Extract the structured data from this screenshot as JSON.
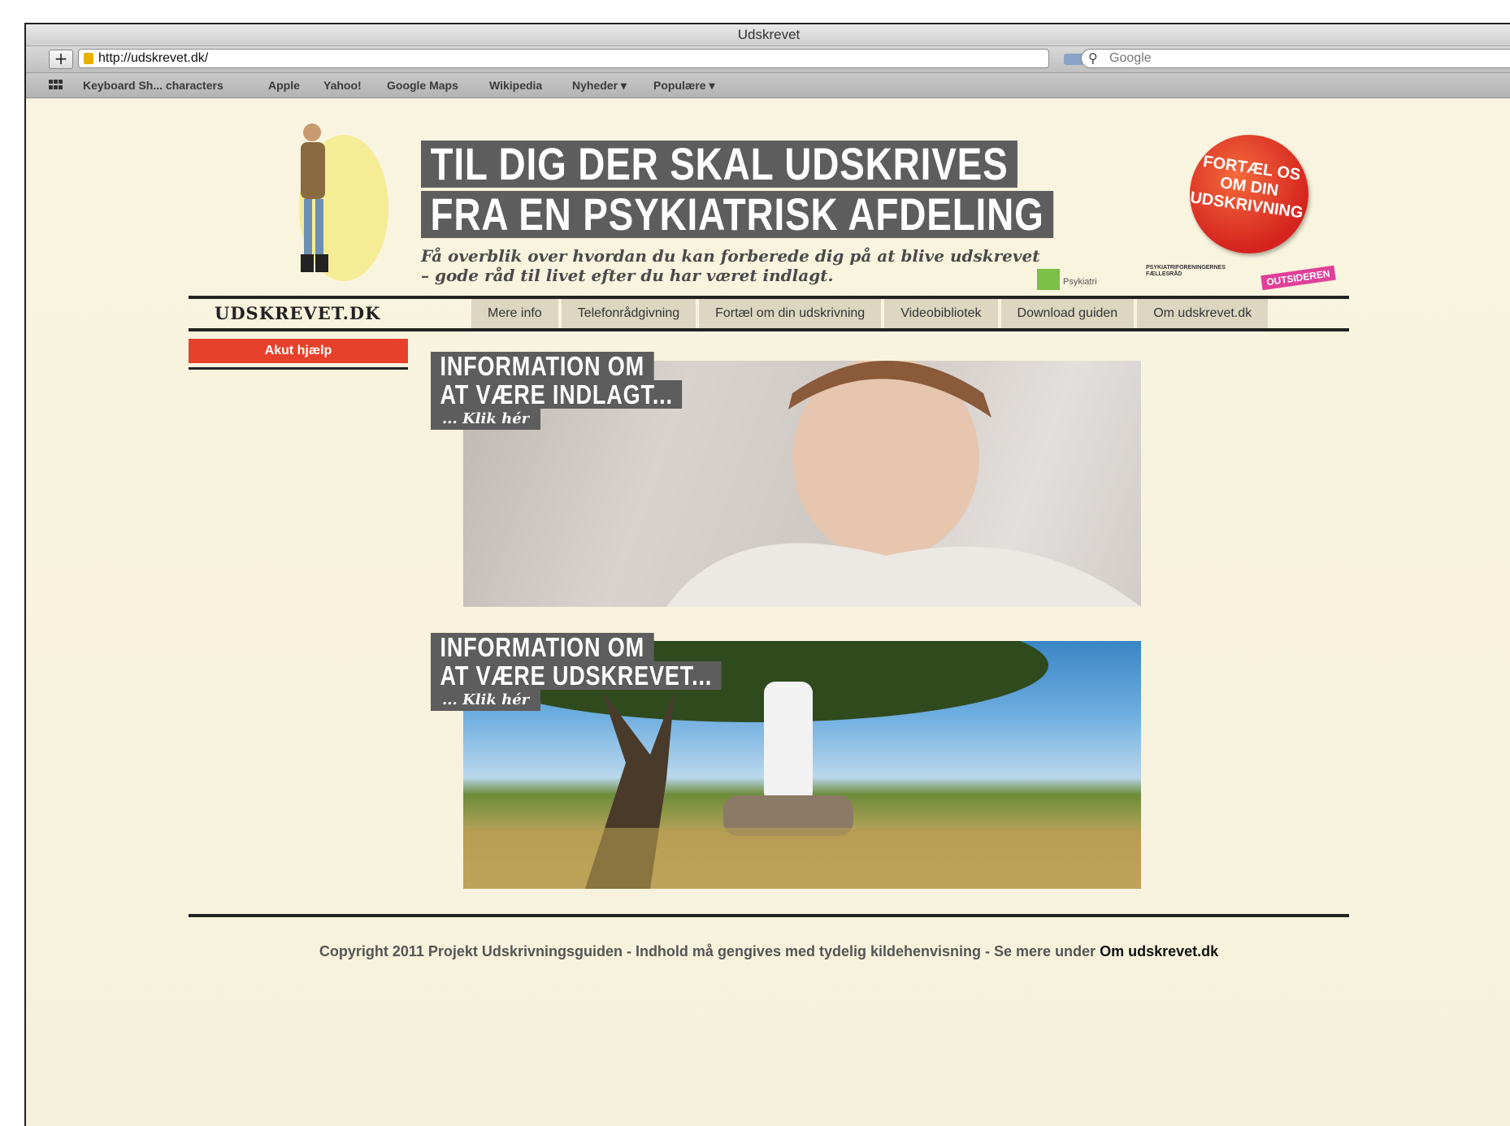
{
  "window": {
    "title": "Udskrevet"
  },
  "toolbar": {
    "add_tab_label": "+",
    "url": "http://udskrevet.dk/",
    "reload_label": "c",
    "search_placeholder": "Google"
  },
  "bookmarks": [
    "Keyboard Sh... characters",
    "Apple",
    "Yahoo!",
    "Google Maps",
    "Wikipedia",
    "Nyheder ▾",
    "Populære ▾"
  ],
  "header": {
    "headline_line1": "TIL DIG DER SKAL UDSKRIVES",
    "headline_line2": "FRA EN PSYKIATRISK AFDELING",
    "subline_1": "Få overblik over hvordan du kan forberede dig på at blive udskrevet",
    "subline_2": "– gode råd til livet efter du har været indlagt.",
    "badge_line1": "FORTÆL OS",
    "badge_line2": "OM DIN",
    "badge_line3": "UDSKRIVNING",
    "logo_psykiatri": "Psykiatri",
    "logo_faelles": "PSYKIATRIFORENINGERNES FÆLLESRÅD",
    "logo_outsideren": "OUTSIDEREN"
  },
  "nav": {
    "site_name": "UDSKREVET.DK",
    "items": [
      "Mere info",
      "Telefonrådgivning",
      "Fortæl om din udskrivning",
      "Videobibliotek",
      "Download guiden",
      "Om udskrevet.dk"
    ]
  },
  "sidebar": {
    "akut_label": "Akut hjælp"
  },
  "features": [
    {
      "line1": "INFORMATION OM",
      "line2": "AT VÆRE INDLAGT...",
      "klik": "... Klik hér"
    },
    {
      "line1": "INFORMATION OM",
      "line2": "AT VÆRE UDSKREVET...",
      "klik": "... Klik hér"
    }
  ],
  "footer": {
    "text": "Copyright 2011 Projekt Udskrivningsguiden - Indhold må gengives med tydelig kildehenvisning - Se mere under ",
    "link": "Om udskrevet.dk"
  },
  "colors": {
    "page_background": "#f7f2de",
    "headline_box": "#5d5d5d",
    "akut_red": "#e8412b",
    "nav_tab": "#ddd7c1",
    "badge_red": "#d5241f"
  }
}
